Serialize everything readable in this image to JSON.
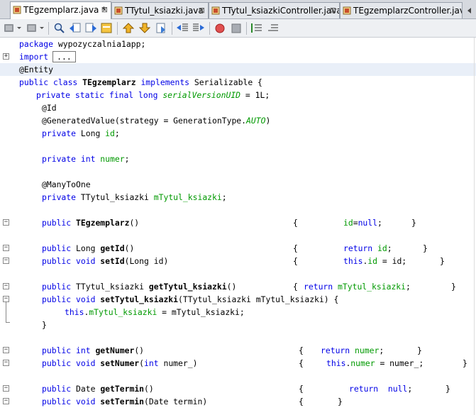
{
  "tabs": [
    {
      "label": "TEgzemplarz.java *",
      "active": true
    },
    {
      "label": "TTytul_ksiazki.java",
      "active": false
    },
    {
      "label": "TTytul_ksiazkiController.java",
      "active": false
    },
    {
      "label": "TEgzemplarzController.java...",
      "active": false
    }
  ],
  "close_glyph": "⊠",
  "toolbar": {
    "icons": [
      "back-icon",
      "back-dropdown-icon",
      "forward-icon",
      "forward-dropdown-icon",
      "find-icon",
      "find-previous-icon",
      "find-next-icon",
      "toggle-highlight-icon",
      "previous-bookmark-icon",
      "next-bookmark-icon",
      "toggle-bookmark-icon",
      "shift-left-icon",
      "shift-right-icon",
      "start-macro-icon",
      "stop-macro-icon",
      "comment-icon",
      "uncomment-icon"
    ]
  },
  "code": {
    "line1": {
      "kw": "package",
      "rest": " wypozyczalnia1app;"
    },
    "line2": {
      "kw": "import",
      "ellipsis": "..."
    },
    "line3": {
      "text": "@Entity"
    },
    "line4": {
      "kw1": "public class",
      "cls": "TEgzemplarz",
      "kw2": "implements",
      "rest": " Serializable {"
    },
    "line5": {
      "kw": "private static final long",
      "field": "serialVersionUID",
      "rest": " = 1L;"
    },
    "line6": {
      "text": "@Id"
    },
    "line7": {
      "pre": "@GeneratedValue(strategy = GenerationType.",
      "enum": "AUTO",
      "post": ")"
    },
    "line8": {
      "kw": "private",
      "rest": " Long ",
      "field": "id",
      "end": ";"
    },
    "line10": {
      "kw": "private int",
      "field": "numer",
      "end": ";"
    },
    "line12": {
      "text": "@ManyToOne"
    },
    "line13": {
      "kw": "private",
      "rest": " TTytul_ksiazki ",
      "field": "mTytul_ksiazki",
      "end": ";"
    },
    "line15": {
      "kw": "public",
      "name": "TEgzemplarz",
      "args": "()",
      "body_open": "{",
      "field": "id",
      "eq": "=",
      "nullkw": "null",
      "semi": ";",
      "body_close": "}"
    },
    "line17": {
      "kw": "public",
      "type": " Long ",
      "name": "getId",
      "args": "()",
      "body_open": "{",
      "retkw": "return",
      "field": "id",
      "semi": ";",
      "body_close": "}"
    },
    "line18": {
      "kw": "public void",
      "name": "setId",
      "args": "(Long id)",
      "body_open": "{",
      "thiskw": "this",
      "field": "id",
      "rest": " = id;",
      "body_close": "}"
    },
    "line20": {
      "kw": "public",
      "type": " TTytul_ksiazki ",
      "name": "getTytul_ksiazki",
      "args": "()",
      "body_open": "{",
      "retkw": "return",
      "field": "mTytul_ksiazki",
      "semi": ";",
      "body_close": "}"
    },
    "line21": {
      "kw": "public void",
      "name": "setTytul_ksiazki",
      "args": "(TTytul_ksiazki mTytul_ksiazki) {"
    },
    "line22": {
      "thiskw": "this",
      "field": "mTytul_ksiazki",
      "rest": " = mTytul_ksiazki;"
    },
    "line23": {
      "text": "}"
    },
    "line25": {
      "kw": "public int",
      "name": "getNumer",
      "args": "()",
      "body_open": "{",
      "retkw": "return",
      "field": "numer",
      "semi": ";",
      "body_close": "}"
    },
    "line26": {
      "kw": "public void",
      "name": "setNumer",
      "args1": "(",
      "argkw": "int",
      "args2": " numer_)",
      "body_open": "{",
      "thiskw": "this",
      "field": "numer",
      "rest": " = numer_;",
      "body_close": "}"
    },
    "line28": {
      "kw": "public",
      "type": " Date ",
      "name": "getTermin",
      "args": "()",
      "body_open": "{",
      "retkw": "return",
      "nullkw": "null",
      "semi": ";",
      "body_close": "}"
    },
    "line29": {
      "kw": "public void",
      "name": "setTermin",
      "args": "(Date termin)",
      "body_open": "{",
      "body_close": "}"
    }
  }
}
